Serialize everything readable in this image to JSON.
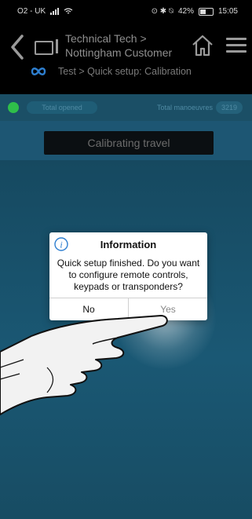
{
  "status_bar": {
    "carrier": "O2 - UK",
    "right_icons": "⊙ ✱ ⍉",
    "battery": "42%",
    "time": "15:05"
  },
  "header": {
    "breadcrumb_top": "Technical Tech > Nottingham Customer",
    "breadcrumb_sub": "Test > Quick setup: Calibration",
    "icons": [
      "back-chevron-icon",
      "tablet-icon",
      "home-icon",
      "hamburger-menu-icon",
      "loop-icon"
    ]
  },
  "info_strip": {
    "total_opened_label": "Total opened",
    "total_manoeuvres_label": "Total manoeuvres",
    "total_manoeuvres_value": "3219",
    "led_color": "#2fbf4a"
  },
  "calibration": {
    "button_label": "Calibrating travel"
  },
  "dialog": {
    "title": "Information",
    "message": "Quick setup finished. Do you want to configure remote controls, keypads or transponders?",
    "no_label": "No",
    "yes_label": "Yes",
    "icon": "info-icon"
  },
  "colors": {
    "header_bg": "#000000",
    "main_bg": "#1a5874",
    "accent_blue": "#2e7fd0"
  }
}
